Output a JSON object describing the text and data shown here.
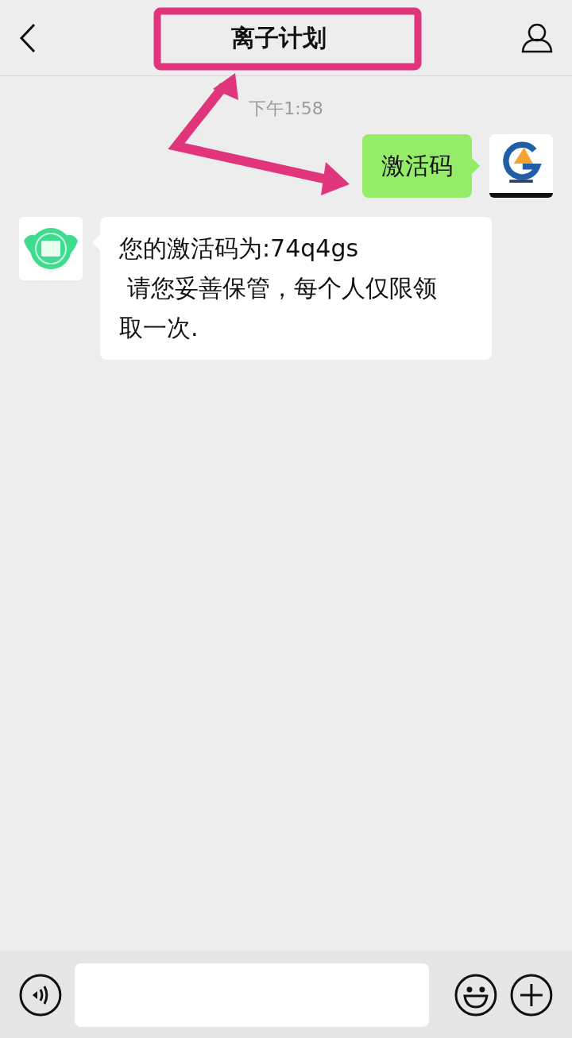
{
  "header": {
    "title": "离子计划"
  },
  "messages": [
    {
      "kind": "time",
      "text": "下午1:58"
    },
    {
      "kind": "sent",
      "text": "激活码"
    },
    {
      "kind": "received",
      "text": "您的激活码为:74q4gs\n 请您妥善保管，每个人仅限领取一次."
    }
  ]
}
